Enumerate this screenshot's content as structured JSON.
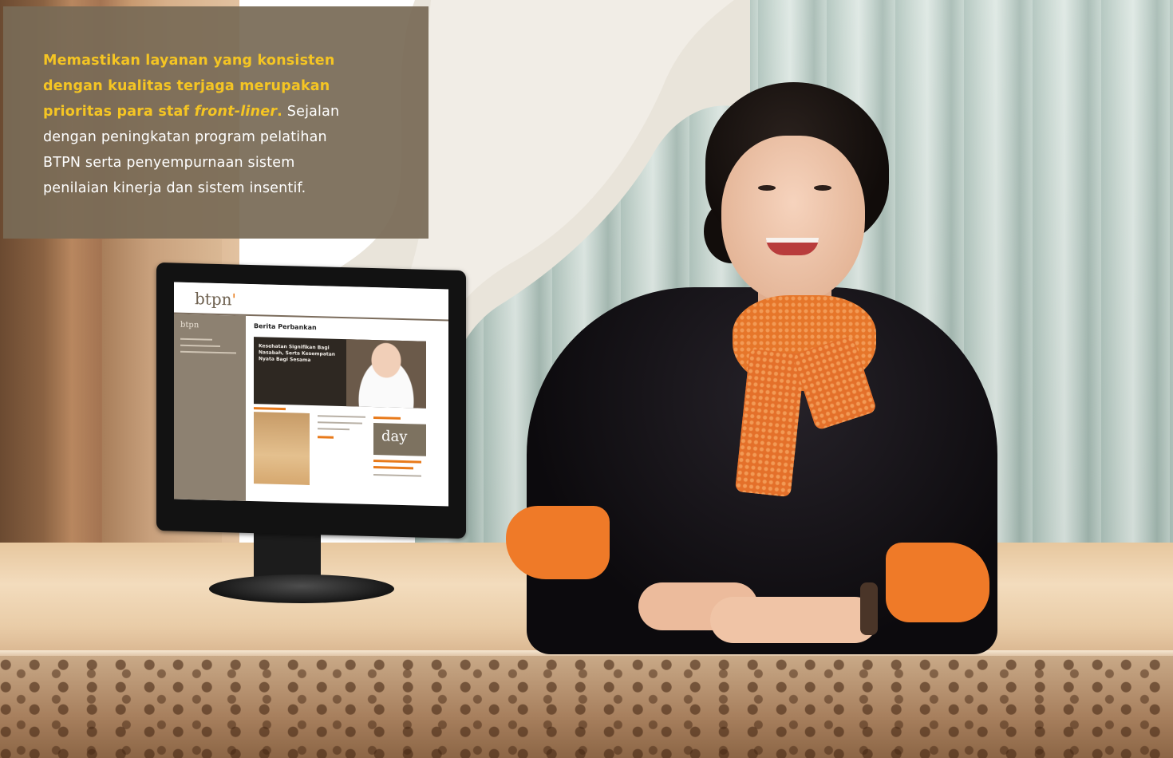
{
  "caption": {
    "highlight_part1": "Memastikan layanan yang konsisten dengan kualitas terjaga merupakan prioritas para staf ",
    "highlight_italic": "front-liner",
    "highlight_end": ".",
    "body": " Sejalan dengan peningkatan program pelatihan BTPN serta penyempurnaan sistem penilaian kinerja dan sistem insentif."
  },
  "monitor_screen": {
    "logo": "btpn",
    "sidebar_logo": "btpn",
    "page_heading": "Berita Perbankan",
    "banner_text": "Kesehatan Signifikan Bagi Nasabah, Serta Kesempatan Nyata Bagi Sesama",
    "side_brand": "day"
  },
  "colors": {
    "overlay_bg": "#786a56",
    "highlight": "#f5c523",
    "scarf": "#e6762a",
    "sleeve": "#ef7a28"
  }
}
